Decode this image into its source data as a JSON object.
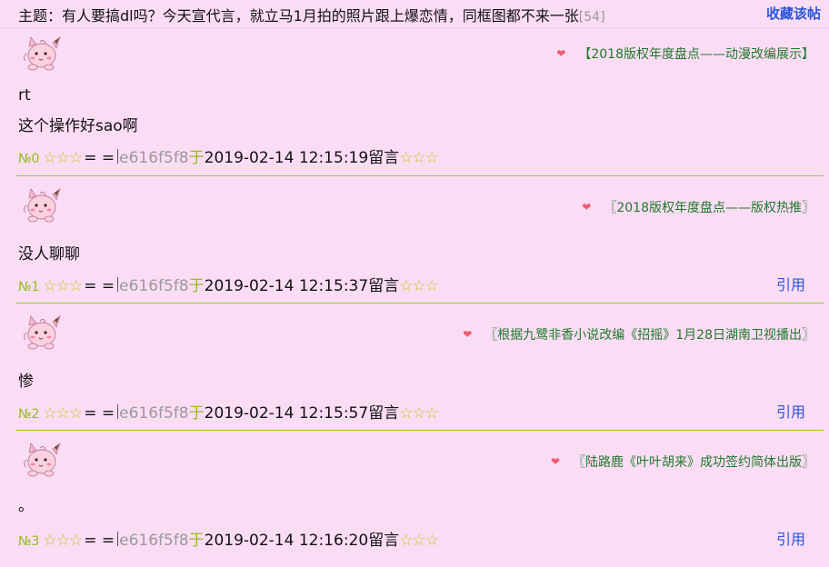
{
  "header": {
    "title": "主题：有人要搞dl吗？今天宣代言，就立马1月拍的照片跟上爆恋情，同框图都不来一张",
    "reply_count": "[54]",
    "favorite_label": "收藏该帖"
  },
  "posts": [
    {
      "ad": "【2018版权年度盘点——动漫改编展示】",
      "lines": [
        "rt",
        "这个操作好sao啊"
      ],
      "no": "№0",
      "stars_left": "☆☆☆",
      "eq": "= =",
      "uid": "e616f5f8",
      "at": "于",
      "time": "2019-02-14 12:15:19",
      "msg": "留言",
      "stars_right": "☆☆☆",
      "quote": ""
    },
    {
      "ad": "〖2018版权年度盘点——版权热推〗",
      "lines": [
        "没人聊聊"
      ],
      "no": "№1",
      "stars_left": "☆☆☆",
      "eq": "= =",
      "uid": "e616f5f8",
      "at": "于",
      "time": "2019-02-14 12:15:37",
      "msg": "留言",
      "stars_right": "☆☆☆",
      "quote": "引用"
    },
    {
      "ad": "〖根据九鹭非香小说改编《招摇》1月28日湖南卫视播出〗",
      "lines": [
        "惨"
      ],
      "no": "№2",
      "stars_left": "☆☆☆",
      "eq": "= =",
      "uid": "e616f5f8",
      "at": "于",
      "time": "2019-02-14 12:15:57",
      "msg": "留言",
      "stars_right": "☆☆☆",
      "quote": "引用"
    },
    {
      "ad": "〖陆路鹿《叶叶胡来》成功签约简体出版〗",
      "lines": [
        "。"
      ],
      "no": "№3",
      "stars_left": "☆☆☆",
      "eq": "= =",
      "uid": "e616f5f8",
      "at": "于",
      "time": "2019-02-14 12:16:20",
      "msg": "留言",
      "stars_right": "☆☆☆",
      "quote": "引用"
    }
  ],
  "icons": {
    "avatar": "clefairy-avatar-icon",
    "heart": "heart-icon"
  },
  "colors": {
    "background": "#fbdcf5",
    "link": "#2a55d6",
    "green": "#8fbf1a",
    "ad_green": "#1f7a2a",
    "heart": "#ef5b6d",
    "star": "#c9c41a"
  }
}
